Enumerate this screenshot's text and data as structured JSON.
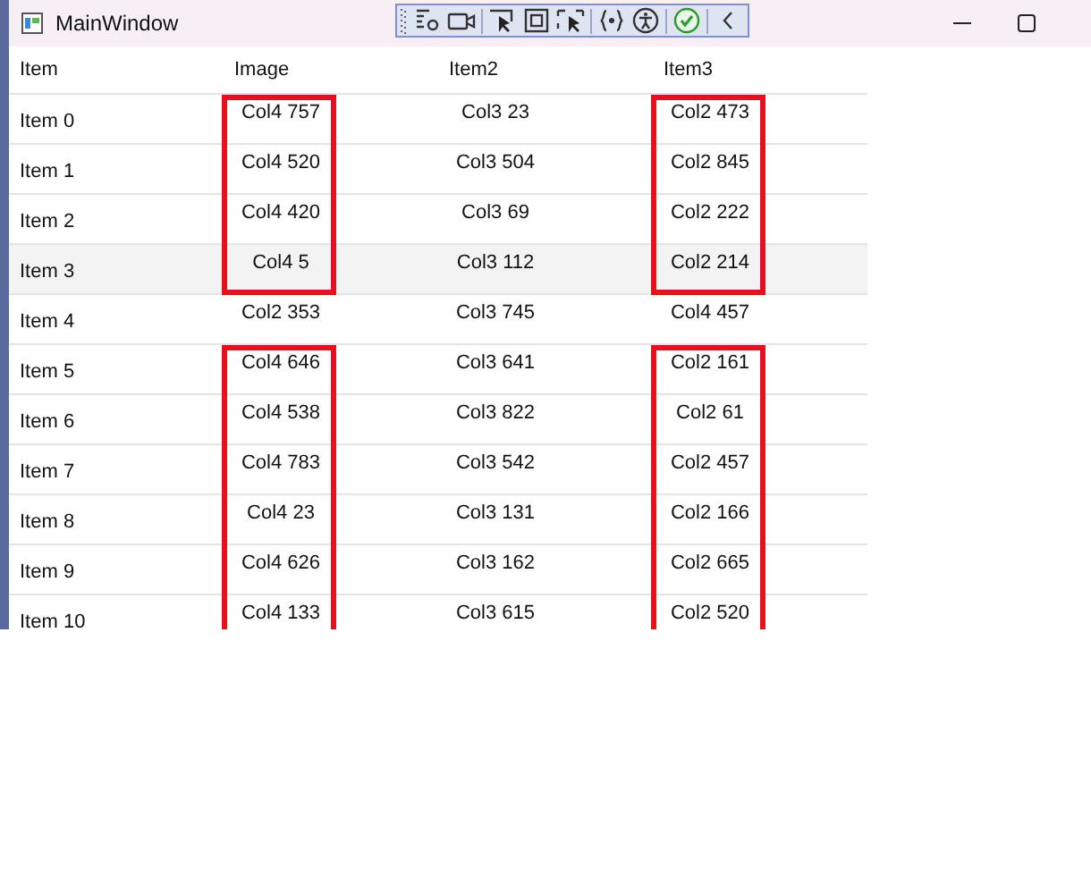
{
  "window": {
    "title": "MainWindow"
  },
  "table": {
    "columns": [
      "Item",
      "Image",
      "Item2",
      "Item3"
    ],
    "rows": [
      {
        "selected": false,
        "cells": [
          {
            "text": "Item 0",
            "boxed": false
          },
          {
            "text": "Col4 757",
            "boxed": true
          },
          {
            "text": "Col3 23",
            "boxed": false
          },
          {
            "text": "Col2 473",
            "boxed": true
          }
        ]
      },
      {
        "selected": false,
        "cells": [
          {
            "text": "Item 1",
            "boxed": false
          },
          {
            "text": "Col4 520",
            "boxed": true
          },
          {
            "text": "Col3 504",
            "boxed": false
          },
          {
            "text": "Col2 845",
            "boxed": true
          }
        ]
      },
      {
        "selected": false,
        "cells": [
          {
            "text": "Item 2",
            "boxed": false
          },
          {
            "text": "Col4 420",
            "boxed": true
          },
          {
            "text": "Col3 69",
            "boxed": false
          },
          {
            "text": "Col2 222",
            "boxed": true
          }
        ]
      },
      {
        "selected": true,
        "cells": [
          {
            "text": "Item 3",
            "boxed": false
          },
          {
            "text": "Col4 5",
            "boxed": true
          },
          {
            "text": "Col3 112",
            "boxed": false
          },
          {
            "text": "Col2 214",
            "boxed": true
          }
        ]
      },
      {
        "selected": false,
        "cells": [
          {
            "text": "Item 4",
            "boxed": false
          },
          {
            "text": "Col2 353",
            "boxed": false
          },
          {
            "text": "Col3 745",
            "boxed": false
          },
          {
            "text": "Col4 457",
            "boxed": false
          }
        ]
      },
      {
        "selected": false,
        "cells": [
          {
            "text": "Item 5",
            "boxed": false
          },
          {
            "text": "Col4 646",
            "boxed": true
          },
          {
            "text": "Col3 641",
            "boxed": false
          },
          {
            "text": "Col2 161",
            "boxed": true
          }
        ]
      },
      {
        "selected": false,
        "cells": [
          {
            "text": "Item 6",
            "boxed": false
          },
          {
            "text": "Col4 538",
            "boxed": true
          },
          {
            "text": "Col3 822",
            "boxed": false
          },
          {
            "text": "Col2 61",
            "boxed": true
          }
        ]
      },
      {
        "selected": false,
        "cells": [
          {
            "text": "Item 7",
            "boxed": false
          },
          {
            "text": "Col4 783",
            "boxed": true
          },
          {
            "text": "Col3 542",
            "boxed": false
          },
          {
            "text": "Col2 457",
            "boxed": true
          }
        ]
      },
      {
        "selected": false,
        "cells": [
          {
            "text": "Item 8",
            "boxed": false
          },
          {
            "text": "Col4 23",
            "boxed": true
          },
          {
            "text": "Col3 131",
            "boxed": false
          },
          {
            "text": "Col2 166",
            "boxed": true
          }
        ]
      },
      {
        "selected": false,
        "cells": [
          {
            "text": "Item 9",
            "boxed": false
          },
          {
            "text": "Col4 626",
            "boxed": true
          },
          {
            "text": "Col3 162",
            "boxed": false
          },
          {
            "text": "Col2 665",
            "boxed": true
          }
        ]
      },
      {
        "selected": false,
        "cells": [
          {
            "text": "Item 10",
            "boxed": false
          },
          {
            "text": "Col4 133",
            "boxed": true
          },
          {
            "text": "Col3 615",
            "boxed": false
          },
          {
            "text": "Col2 520",
            "boxed": true
          }
        ]
      }
    ]
  }
}
